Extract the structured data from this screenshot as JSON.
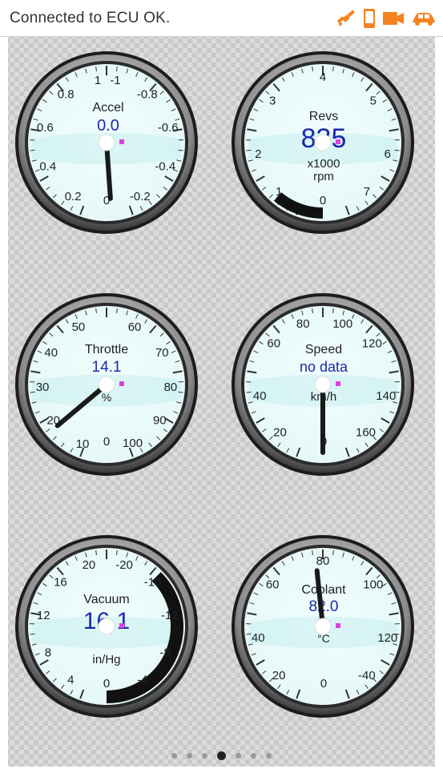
{
  "status": {
    "message": "Connected to ECU OK.",
    "icons": [
      "satellite-icon",
      "phone-icon",
      "camera-icon",
      "car-icon"
    ],
    "icon_color": "#f58220"
  },
  "gauges": [
    {
      "id": "accel",
      "label": "Accel",
      "value": "0.0",
      "unit": "",
      "ticks": [
        "0.2",
        "0.4",
        "0.6",
        "0.8",
        "1",
        "-1",
        "-0.8",
        "-0.6",
        "-0.4",
        "-0.2"
      ],
      "bottom_label": "0",
      "needle_value": 0.0,
      "needle_angle_deg": 180
    },
    {
      "id": "revs",
      "label": "Revs",
      "value": "835",
      "unit_line1": "x1000",
      "unit_line2": "rpm",
      "ticks": [
        "1",
        "2",
        "3",
        "4",
        "5",
        "6",
        "7"
      ],
      "bottom_label": "0",
      "needle_value": 0.835,
      "needle_angle_deg": 205
    },
    {
      "id": "throttle",
      "label": "Throttle",
      "value": "14.1",
      "unit": "%",
      "ticks": [
        "10",
        "20",
        "30",
        "40",
        "50",
        "60",
        "70",
        "80",
        "90",
        "100"
      ],
      "bottom_label": "0",
      "needle_value": 14.1
    },
    {
      "id": "speed",
      "label": "Speed",
      "value": "no data",
      "unit": "km/h",
      "ticks": [
        "20",
        "40",
        "60",
        "80",
        "100",
        "120",
        "140",
        "160"
      ],
      "bottom_label": "0",
      "needle_value": 0
    },
    {
      "id": "vacuum",
      "label": "Vacuum",
      "value": "16.1",
      "unit": "in/Hg",
      "ticks": [
        "4",
        "8",
        "12",
        "16",
        "20",
        "-20",
        "-16",
        "-12",
        "-8",
        "-4"
      ],
      "bottom_label": "0",
      "needle_value": 16.1
    },
    {
      "id": "coolant",
      "label": "Coolant",
      "value": "82.0",
      "unit": "°C",
      "ticks": [
        "20",
        "40",
        "60",
        "80",
        "100",
        "120",
        "-40"
      ],
      "bottom_label": "0",
      "needle_value": 82.0
    }
  ],
  "colors": {
    "value_blue": "#1a2aa8",
    "dial_face": "#e6f8f8",
    "needle": "#1a1a1a",
    "marker": "#e040e0",
    "tick_marker": "#22aadd"
  },
  "pager": {
    "count": 7,
    "active_index": 3
  }
}
